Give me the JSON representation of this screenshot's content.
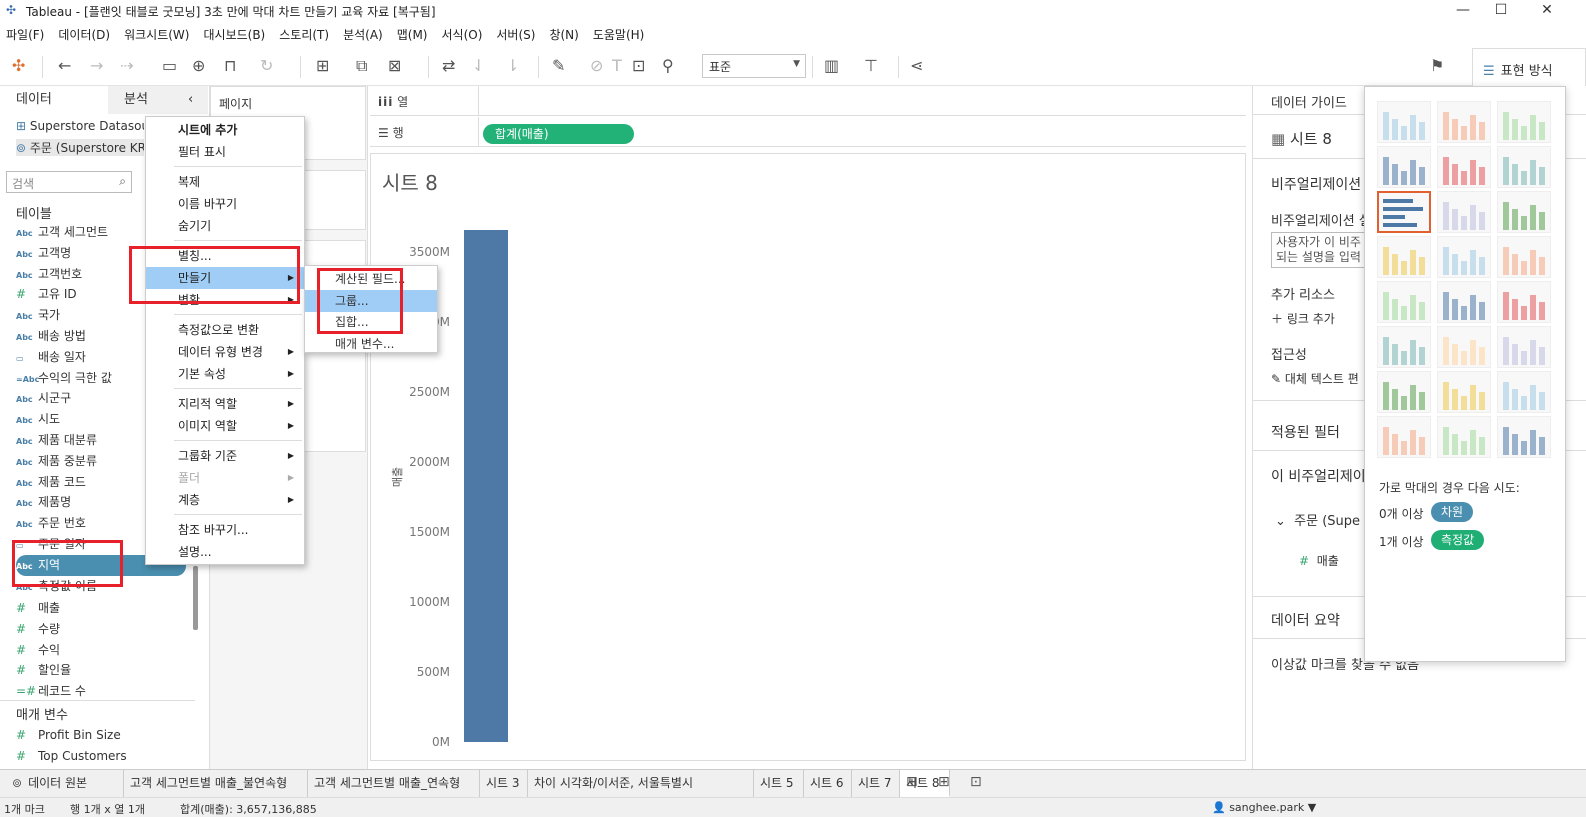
{
  "window": {
    "title": "Tableau - [플랜잇 태블로 굿모닝] 3초 만에 막대 차트 만들기 교육 자료 [복구됨]"
  },
  "menu": [
    "파일(F)",
    "데이터(D)",
    "워크시트(W)",
    "대시보드(B)",
    "스토리(T)",
    "분석(A)",
    "맵(M)",
    "서식(O)",
    "서버(S)",
    "창(N)",
    "도움말(H)"
  ],
  "toolbar": {
    "fit": "표준",
    "showme_label": "표현 방식"
  },
  "left": {
    "tab_data": "데이터",
    "tab_analysis": "분석",
    "sources": [
      "Superstore Datasource",
      "주문 (Superstore KR)"
    ],
    "search_placeholder": "검색",
    "tables_label": "테이블",
    "dimensions": [
      {
        "type": "Abc",
        "name": "고객 세그먼트"
      },
      {
        "type": "Abc",
        "name": "고객명"
      },
      {
        "type": "Abc",
        "name": "고객번호"
      },
      {
        "type": "#",
        "name": "고유 ID"
      },
      {
        "type": "Abc",
        "name": "국가"
      },
      {
        "type": "Abc",
        "name": "배송 방법"
      },
      {
        "type": "date",
        "name": "배송 일자"
      },
      {
        "type": "=Abc",
        "name": "수익의 극한 값"
      },
      {
        "type": "Abc",
        "name": "시군구"
      },
      {
        "type": "Abc",
        "name": "시도"
      },
      {
        "type": "Abc",
        "name": "제품 대분류"
      },
      {
        "type": "Abc",
        "name": "제품 중분류"
      },
      {
        "type": "Abc",
        "name": "제품 코드"
      },
      {
        "type": "Abc",
        "name": "제품명"
      },
      {
        "type": "Abc",
        "name": "주문 번호"
      },
      {
        "type": "date",
        "name": "주문 일자"
      },
      {
        "type": "Abc",
        "name": "지역"
      },
      {
        "type": "Abc",
        "name": "측정값 이름"
      }
    ],
    "measures": [
      {
        "type": "#",
        "name": "매출"
      },
      {
        "type": "#",
        "name": "수량"
      },
      {
        "type": "#",
        "name": "수익"
      },
      {
        "type": "#",
        "name": "할인율"
      },
      {
        "type": "=#",
        "name": "레코드 수"
      }
    ],
    "params_label": "매개 변수",
    "params": [
      {
        "type": "#",
        "name": "Profit Bin Size"
      },
      {
        "type": "#",
        "name": "Top Customers"
      }
    ]
  },
  "shelves": {
    "pages": "페이지",
    "columns": "열",
    "rows": "행",
    "row_pill": "합계(매출)"
  },
  "context_menu": [
    {
      "label": "시트에 추가",
      "bold": true
    },
    {
      "label": "필터 표시"
    },
    {
      "sep": true
    },
    {
      "label": "복제"
    },
    {
      "label": "이름 바꾸기"
    },
    {
      "label": "숨기기"
    },
    {
      "sep": true
    },
    {
      "label": "별칭..."
    },
    {
      "label": "만들기",
      "sub": true,
      "hl": true
    },
    {
      "label": "변환",
      "sub": true
    },
    {
      "sep": true
    },
    {
      "label": "측정값으로 변환"
    },
    {
      "label": "데이터 유형 변경",
      "sub": true
    },
    {
      "label": "기본 속성",
      "sub": true
    },
    {
      "sep": true
    },
    {
      "label": "지리적 역할",
      "sub": true
    },
    {
      "label": "이미지 역할",
      "sub": true
    },
    {
      "sep": true
    },
    {
      "label": "그룹화 기준",
      "sub": true
    },
    {
      "label": "폴더",
      "sub": true,
      "dis": true
    },
    {
      "label": "계층",
      "sub": true
    },
    {
      "sep": true
    },
    {
      "label": "참조 바꾸기..."
    },
    {
      "label": "설명..."
    }
  ],
  "submenu": [
    {
      "label": "계산된 필드..."
    },
    {
      "label": "그룹...",
      "hl": true
    },
    {
      "label": "집합..."
    },
    {
      "label": "매개 변수..."
    }
  ],
  "sheet": {
    "title": "시트 8"
  },
  "chart_data": {
    "type": "bar",
    "categories": [
      ""
    ],
    "values": [
      3657136885
    ],
    "ylabel": "매출",
    "ylim": [
      0,
      3800000000
    ],
    "yticks": [
      {
        "v": 0,
        "label": "0M"
      },
      {
        "v": 500000000,
        "label": "500M"
      },
      {
        "v": 1000000000,
        "label": "1000M"
      },
      {
        "v": 1500000000,
        "label": "1500M"
      },
      {
        "v": 2000000000,
        "label": "2000M"
      },
      {
        "v": 2500000000,
        "label": "2500M"
      },
      {
        "v": 3000000000,
        "label": "3000M"
      },
      {
        "v": 3500000000,
        "label": "3500M"
      }
    ],
    "bar_color": "#4e79a7"
  },
  "right": {
    "title": "데이터 가이드",
    "sheet": "시트 8",
    "viz_heading": "비주얼리제이션",
    "viz_desc_label": "비주얼리제이션 설",
    "viz_desc_line1": "사용자가 이 비주",
    "viz_desc_line2": "되는 설명을 입력",
    "resources": "추가 리소스",
    "add_link": "링크 추가",
    "accessibility": "접근성",
    "alt_text": "대체 텍스트 편",
    "filters": "적용된 필터",
    "this_viz": "이 비주얼리제이",
    "source": "주문 (Supe",
    "measure": "매출",
    "summary": "데이터 요약",
    "outliers": "이상값 마크를 찾을 수 없음"
  },
  "showme": {
    "hint": "가로 막대의 경우 다음 시도:",
    "row1_prefix": "0개 이상",
    "row1_badge": "차원",
    "row2_prefix": "1개 이상",
    "row2_badge": "측정값",
    "dim_color": "#4a8fb0",
    "mea_color": "#1fae74"
  },
  "tabs": [
    "데이터 원본",
    "고객 세그먼트별 매출_불연속형",
    "고객 세그먼트별 매출_연속형",
    "시트 3",
    "차이 시각화/이서준, 서울특별시",
    "시트 5",
    "시트 6",
    "시트 7",
    "시트 8"
  ],
  "status": {
    "marks": "1개 마크",
    "rc": "행 1개 x 열 1개",
    "sum": "합계(매출): 3,657,136,885",
    "user": "sanghee.park"
  }
}
